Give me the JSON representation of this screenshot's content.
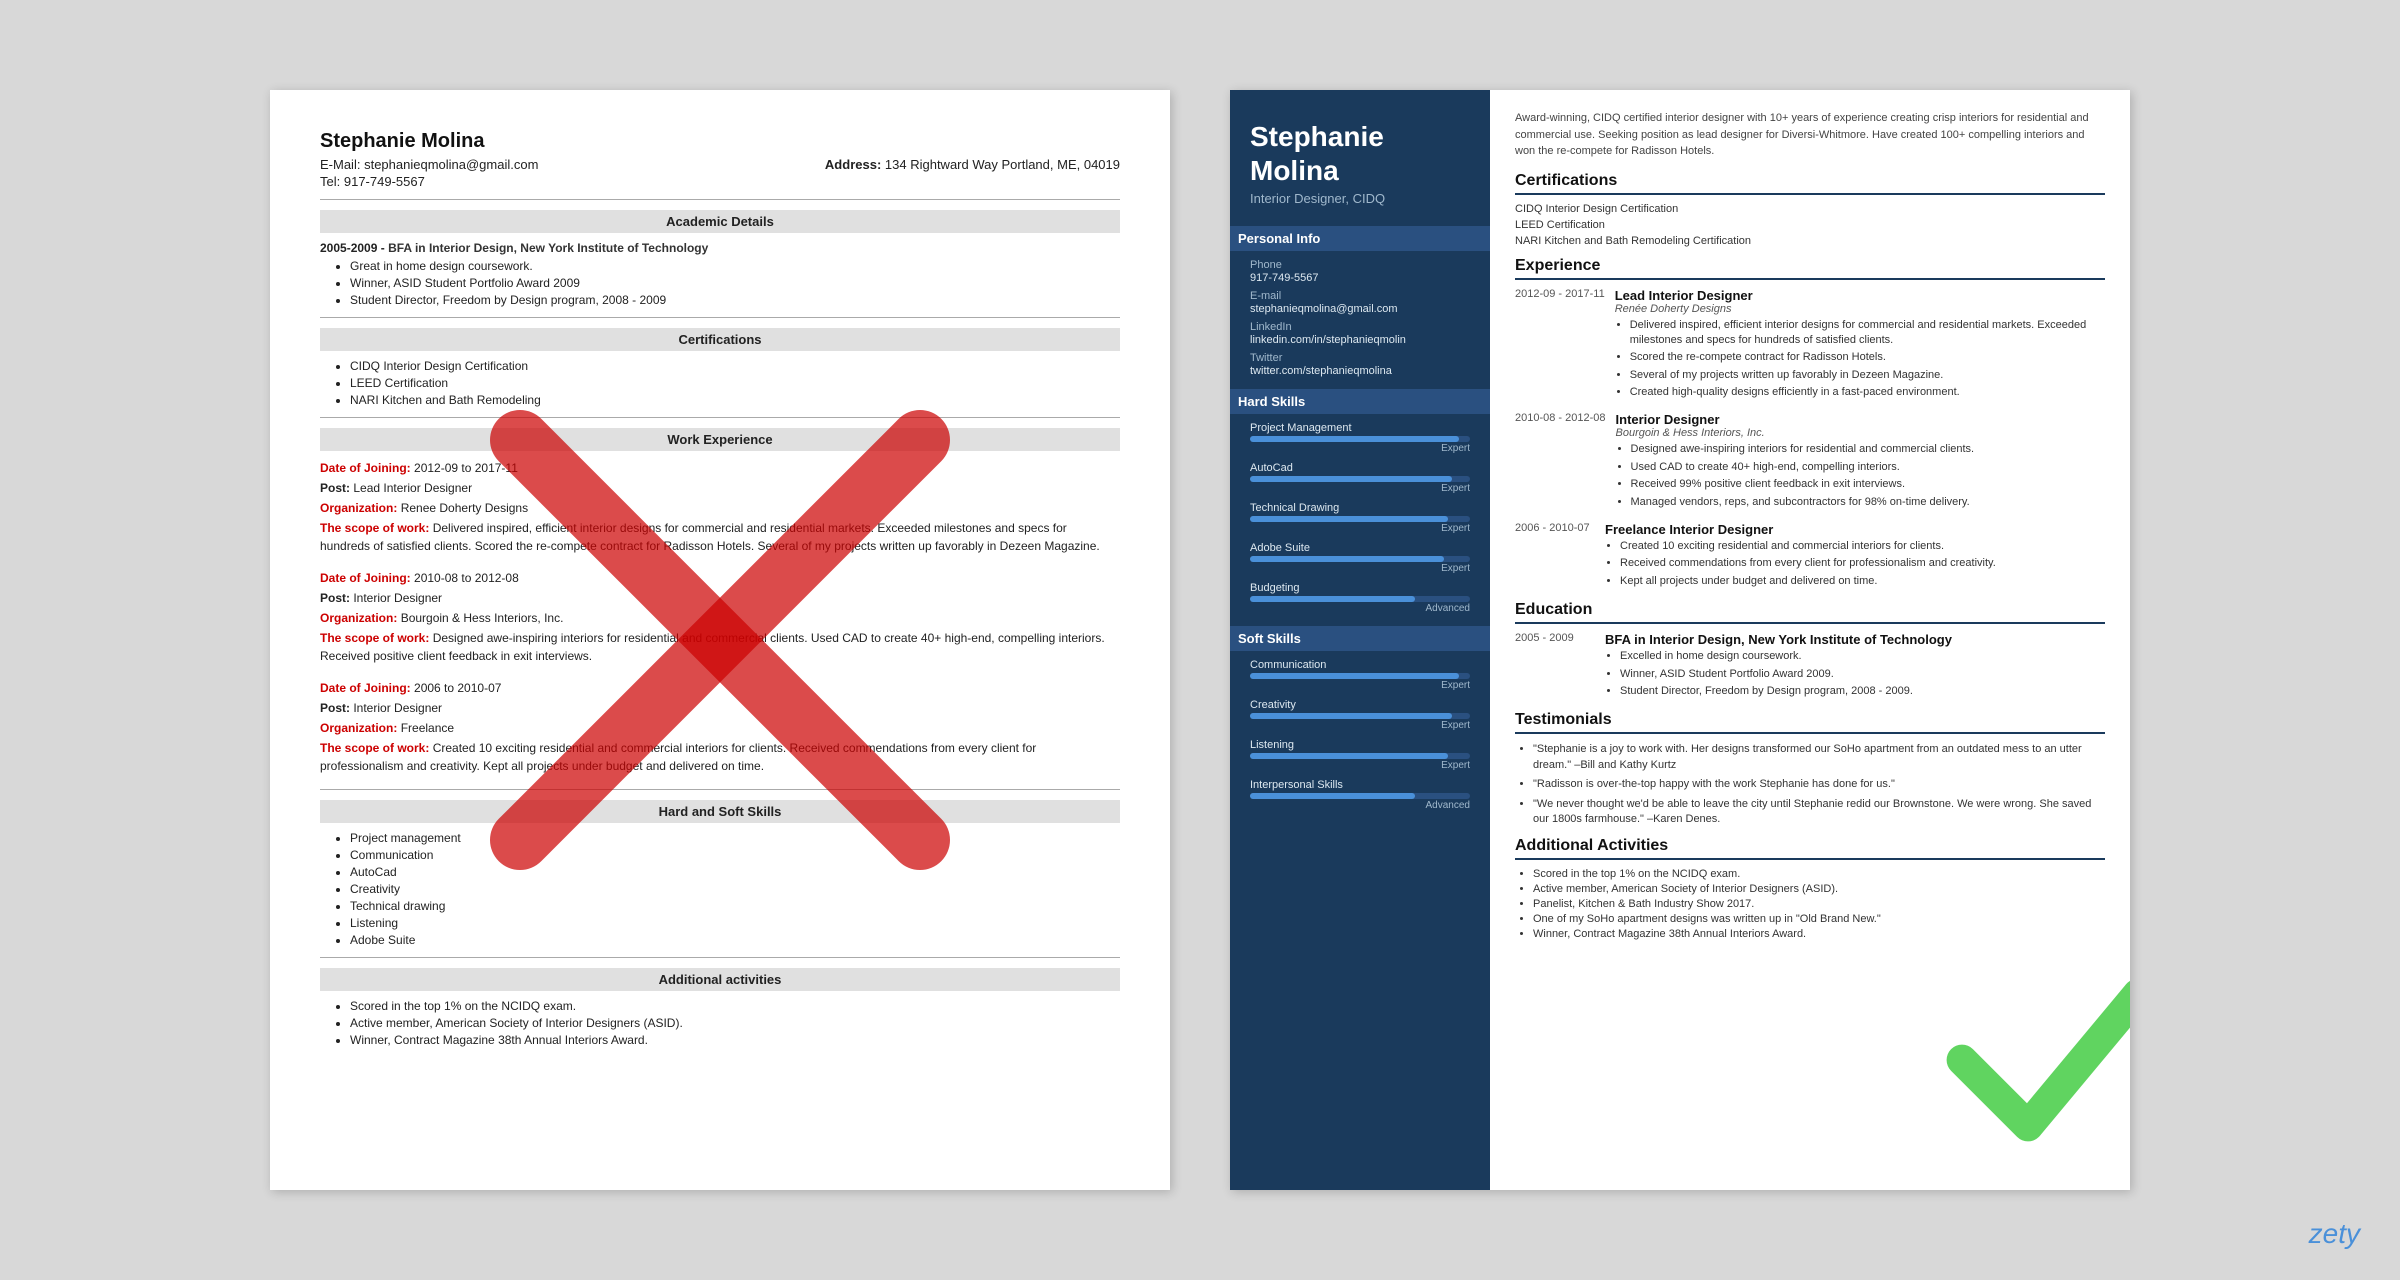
{
  "page": {
    "background": "#d8d8d8"
  },
  "left_resume": {
    "name": "Stephanie Molina",
    "email_label": "E-Mail:",
    "email": "stephanieqmolina@gmail.com",
    "address_label": "Address:",
    "address": "134 Rightward Way Portland, ME, 04019",
    "tel_label": "Tel:",
    "tel": "917-749-5567",
    "sections": {
      "academic": "Academic Details",
      "certifications": "Certifications",
      "work_experience": "Work Experience",
      "hard_soft_skills": "Hard and Soft Skills",
      "additional": "Additional activities"
    },
    "academic": {
      "degree": "2005-2009 - BFA in Interior Design, New York Institute of Technology",
      "bullets": [
        "Great in home design coursework.",
        "Winner, ASID Student Portfolio Award 2009",
        "Student Director, Freedom by Design program, 2008 - 2009"
      ]
    },
    "certifications": [
      "CIDQ Interior Design Certification",
      "LEED Certification",
      "NARI Kitchen and Bath Remodeling"
    ],
    "work_experience": [
      {
        "date_of_joining": "Date of Joining:",
        "date": "2012-09 to 2017-11",
        "post_label": "Post:",
        "post": "Lead Interior Designer",
        "org_label": "Organization:",
        "org": "Renee Doherty Designs",
        "scope_label": "The scope of work:",
        "scope": "Delivered inspired, efficient interior designs for commercial and residential markets. Exceeded milestones and specs for hundreds of satisfied clients. Scored the re-compete contract for Radisson Hotels. Several of my projects written up favorably in Dezeen Magazine."
      },
      {
        "date_of_joining": "Date of Joining:",
        "date": "2010-08 to 2012-08",
        "post_label": "Post:",
        "post": "Interior Designer",
        "org_label": "Organization:",
        "org": "Bourgoin & Hess Interiors, Inc.",
        "scope_label": "The scope of work:",
        "scope": "Designed awe-inspiring interiors for residential and commercial clients. Used CAD to create 40+ high-end, compelling interiors. Received positive client feedback in exit interviews."
      },
      {
        "date_of_joining": "Date of Joining:",
        "date": "2006 to 2010-07",
        "post_label": "Post:",
        "post": "Interior Designer",
        "org_label": "Organization:",
        "org": "Freelance",
        "scope_label": "The scope of work:",
        "scope": "Created 10 exciting residential and commercial interiors for clients. Received commendations from every client for professionalism and creativity. Kept all projects under budget and delivered on time."
      }
    ],
    "skills": [
      "Project management",
      "Communication",
      "AutoCad",
      "Creativity",
      "Technical drawing",
      "Listening",
      "Adobe Suite"
    ],
    "additional": [
      "Scored in the top 1% on the NCIDQ exam.",
      "Active member, American Society of Interior Designers (ASID).",
      "Winner, Contract Magazine 38th Annual Interiors Award."
    ]
  },
  "right_resume": {
    "name": "Stephanie Molina",
    "title": "Interior Designer, CIDQ",
    "summary": "Award-winning, CIDQ certified interior designer with 10+ years of experience creating crisp interiors for residential and commercial use. Seeking position as lead designer for Diversi-Whitmore. Have created 100+ compelling interiors and won the re-compete for Radisson Hotels.",
    "personal_info": {
      "section_title": "Personal Info",
      "phone_label": "Phone",
      "phone": "917-749-5567",
      "email_label": "E-mail",
      "email": "stephanieqmolina@gmail.com",
      "linkedin_label": "LinkedIn",
      "linkedin": "linkedin.com/in/stephanieqmolin",
      "twitter_label": "Twitter",
      "twitter": "twitter.com/stephanieqmolina"
    },
    "hard_skills": {
      "section_title": "Hard Skills",
      "skills": [
        {
          "name": "Project Management",
          "level": "Expert",
          "pct": 95
        },
        {
          "name": "AutoCad",
          "level": "Expert",
          "pct": 92
        },
        {
          "name": "Technical Drawing",
          "level": "Expert",
          "pct": 90
        },
        {
          "name": "Adobe Suite",
          "level": "Expert",
          "pct": 88
        },
        {
          "name": "Budgeting",
          "level": "Advanced",
          "pct": 75
        }
      ]
    },
    "soft_skills": {
      "section_title": "Soft Skills",
      "skills": [
        {
          "name": "Communication",
          "level": "Expert",
          "pct": 95
        },
        {
          "name": "Creativity",
          "level": "Expert",
          "pct": 92
        },
        {
          "name": "Listening",
          "level": "Expert",
          "pct": 90
        },
        {
          "name": "Interpersonal Skills",
          "level": "Advanced",
          "pct": 75
        }
      ]
    },
    "certifications": {
      "section_title": "Certifications",
      "items": [
        "CIDQ Interior Design Certification",
        "LEED Certification",
        "NARI Kitchen and Bath Remodeling Certification"
      ]
    },
    "experience": {
      "section_title": "Experience",
      "jobs": [
        {
          "dates": "2012-09 - 2017-11",
          "title": "Lead Interior Designer",
          "company": "Renée Doherty Designs",
          "bullets": [
            "Delivered inspired, efficient interior designs for commercial and residential markets. Exceeded milestones and specs for hundreds of satisfied clients.",
            "Scored the re-compete contract for Radisson Hotels.",
            "Several of my projects written up favorably in Dezeen Magazine.",
            "Created high-quality designs efficiently in a fast-paced environment."
          ]
        },
        {
          "dates": "2010-08 - 2012-08",
          "title": "Interior Designer",
          "company": "Bourgoin & Hess Interiors, Inc.",
          "bullets": [
            "Designed awe-inspiring interiors for residential and commercial clients.",
            "Used CAD to create 40+ high-end, compelling interiors.",
            "Received 99% positive client feedback in exit interviews.",
            "Managed vendors, reps, and subcontractors for 98% on-time delivery."
          ]
        },
        {
          "dates": "2006 - 2010-07",
          "title": "Freelance Interior Designer",
          "company": "",
          "bullets": [
            "Created 10 exciting residential and commercial interiors for clients.",
            "Received commendations from every client for professionalism and creativity.",
            "Kept all projects under budget and delivered on time."
          ]
        }
      ]
    },
    "education": {
      "section_title": "Education",
      "items": [
        {
          "dates": "2005 - 2009",
          "degree": "BFA in Interior Design, New York Institute of Technology",
          "bullets": [
            "Excelled in home design coursework.",
            "Winner, ASID Student Portfolio Award 2009.",
            "Student Director, Freedom by Design program, 2008 - 2009."
          ]
        }
      ]
    },
    "testimonials": {
      "section_title": "Testimonials",
      "items": [
        "\"Stephanie is a joy to work with. Her designs transformed our SoHo apartment from an outdated mess to an utter dream.\" –Bill and Kathy Kurtz",
        "\"Radisson is over-the-top happy with the work Stephanie has done for us.\"",
        "\"We never thought we'd be able to leave the city until Stephanie redid our Brownstone. We were wrong. She saved our 1800s farmhouse.\" –Karen Denes."
      ]
    },
    "additional_activities": {
      "section_title": "Additional Activities",
      "items": [
        "Scored in the top 1% on the NCIDQ exam.",
        "Active member, American Society of Interior Designers (ASID).",
        "Panelist, Kitchen & Bath Industry Show 2017.",
        "One of my SoHo apartment designs was written up in \"Old Brand New.\"",
        "Winner, Contract Magazine 38th Annual Interiors Award."
      ]
    }
  },
  "zety": {
    "logo": "zety"
  }
}
